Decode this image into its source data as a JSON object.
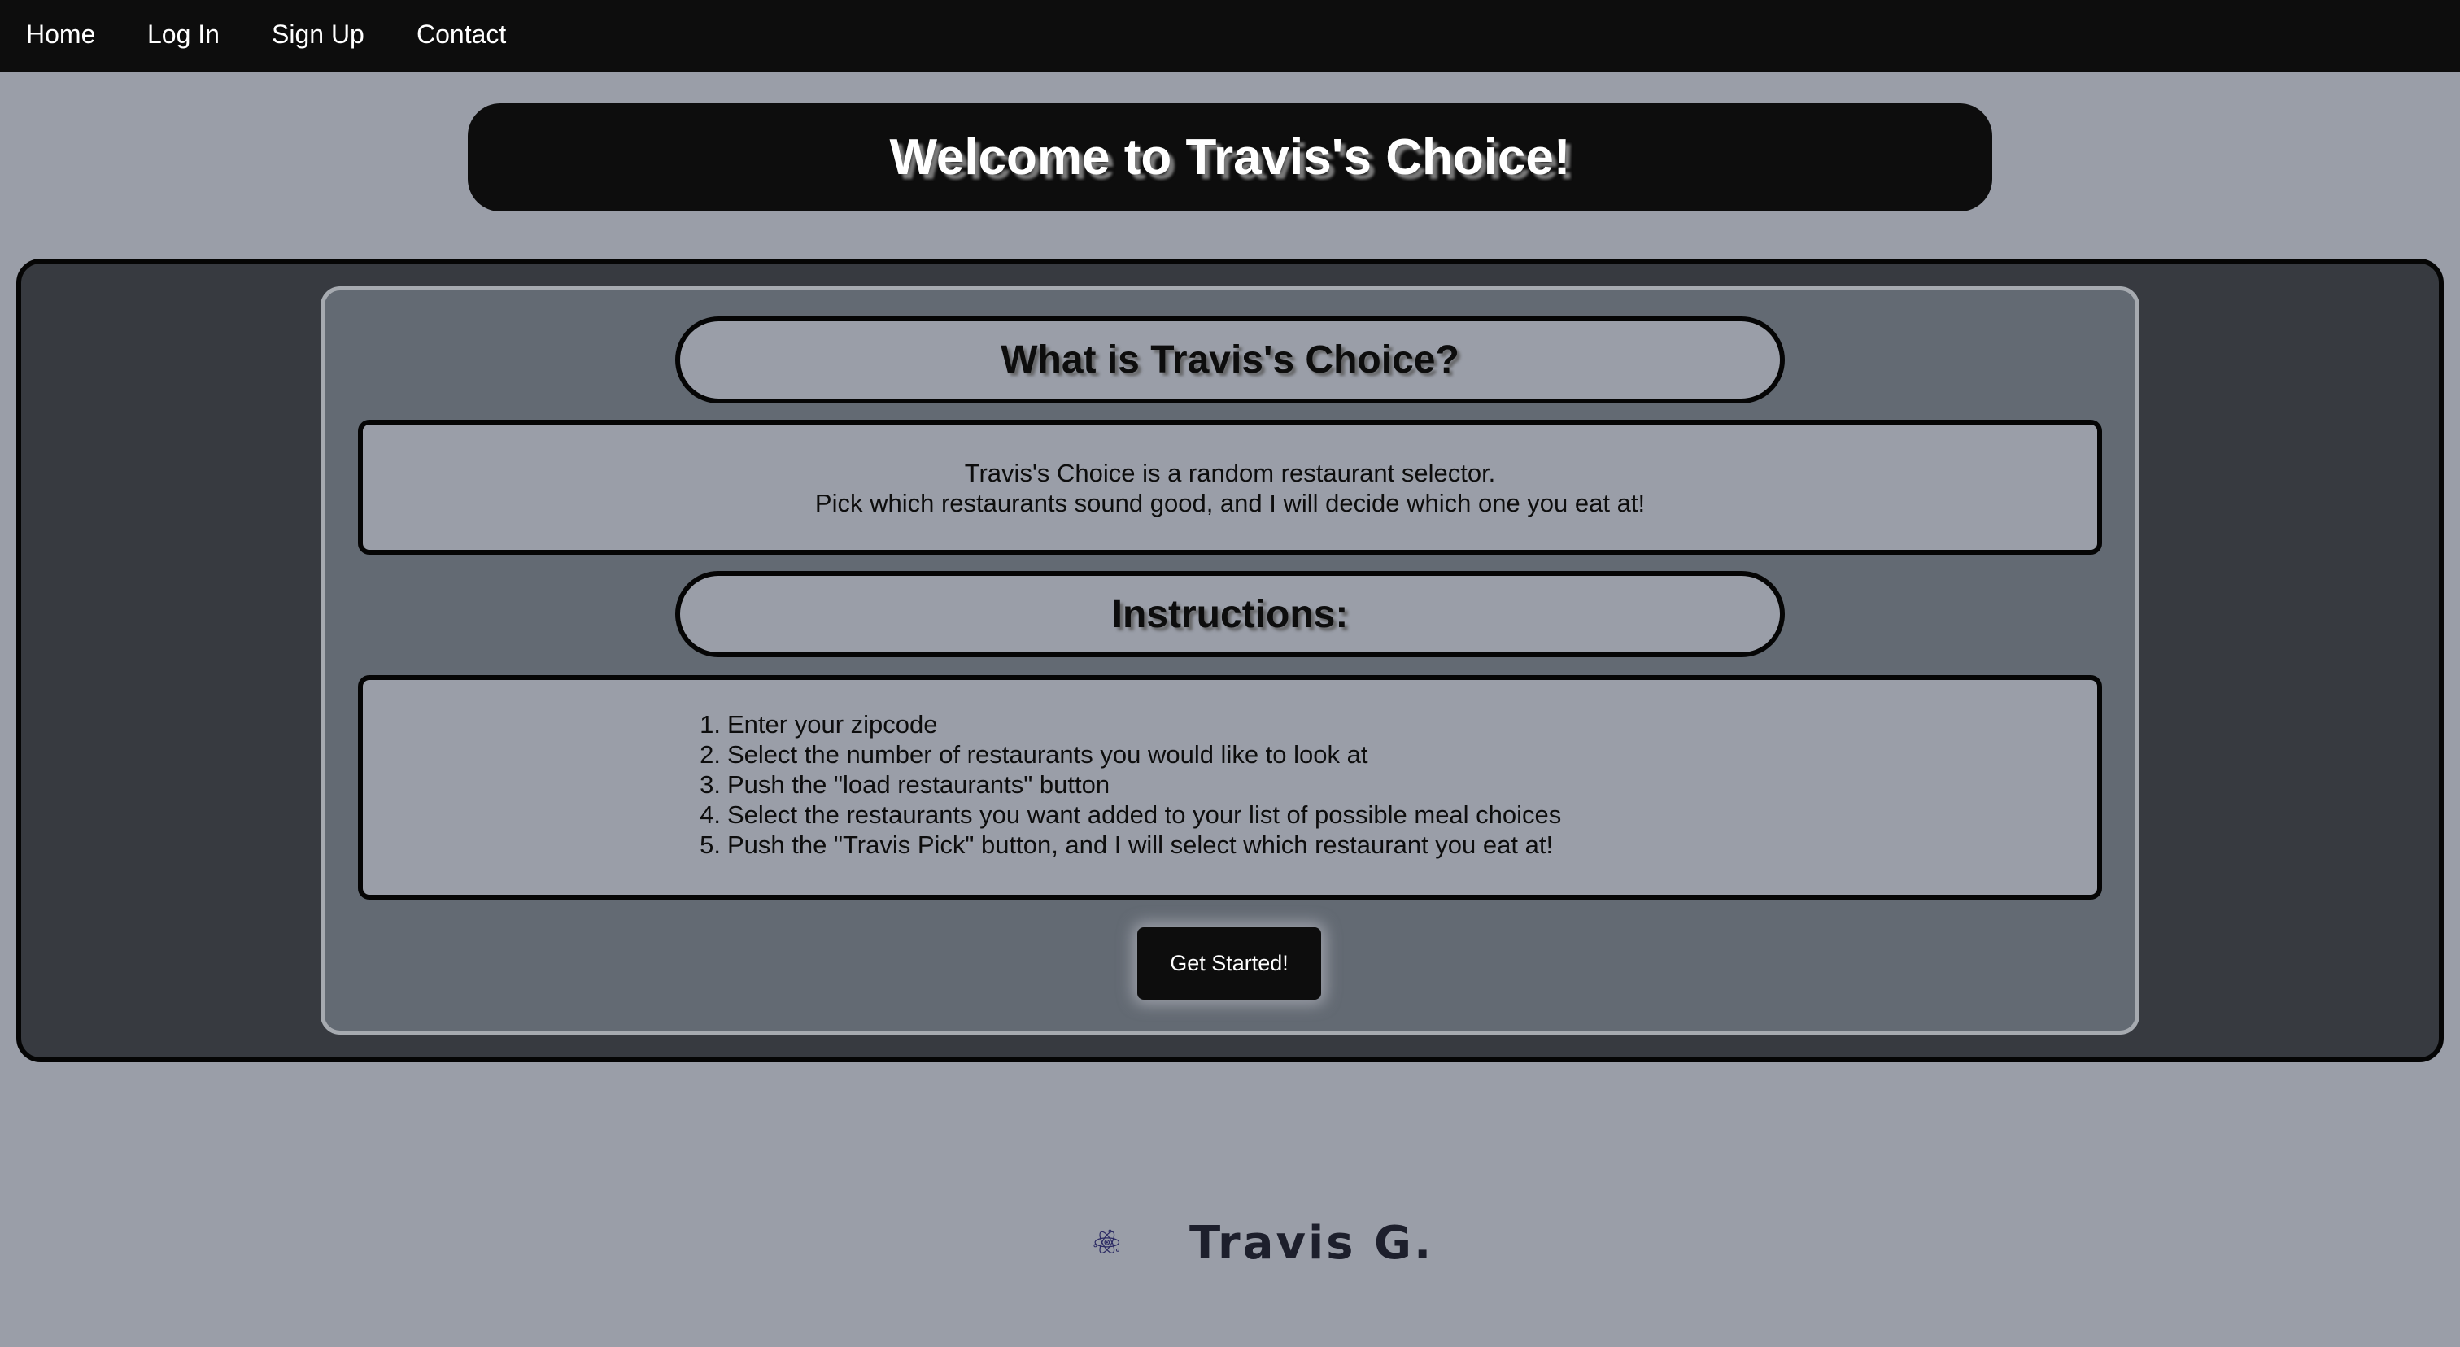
{
  "nav": {
    "items": [
      {
        "label": "Home"
      },
      {
        "label": "Log In"
      },
      {
        "label": "Sign Up"
      },
      {
        "label": "Contact"
      }
    ]
  },
  "banner": {
    "title": "Welcome to Travis's Choice!"
  },
  "about": {
    "heading": "What is Travis's Choice?",
    "line1": "Travis's Choice is a random restaurant selector.",
    "line2": "Pick which restaurants sound good, and I will decide which one you eat at!"
  },
  "instructions": {
    "heading": "Instructions:",
    "steps": [
      {
        "num": "1.",
        "text": "Enter your zipcode"
      },
      {
        "num": "2.",
        "text": "Select the number of restaurants you would like to look at"
      },
      {
        "num": "3.",
        "text": "Push the \"load restaurants\" button"
      },
      {
        "num": "4.",
        "text": "Select the restaurants you want added to your list of possible meal choices"
      },
      {
        "num": "5.",
        "text": "Push the \"Travis Pick\" button, and I will select which restaurant you eat at!"
      }
    ]
  },
  "cta": {
    "label": "Get Started!"
  },
  "footer": {
    "logo_icon": "atom-icon",
    "logo_text": "Travis G.",
    "logo_color": "#2b2a63"
  },
  "colors": {
    "page_bg": "#9a9ea8",
    "nav_bg": "#0d0d0d",
    "outer_panel": "#373a40",
    "inner_panel": "#636a73"
  }
}
